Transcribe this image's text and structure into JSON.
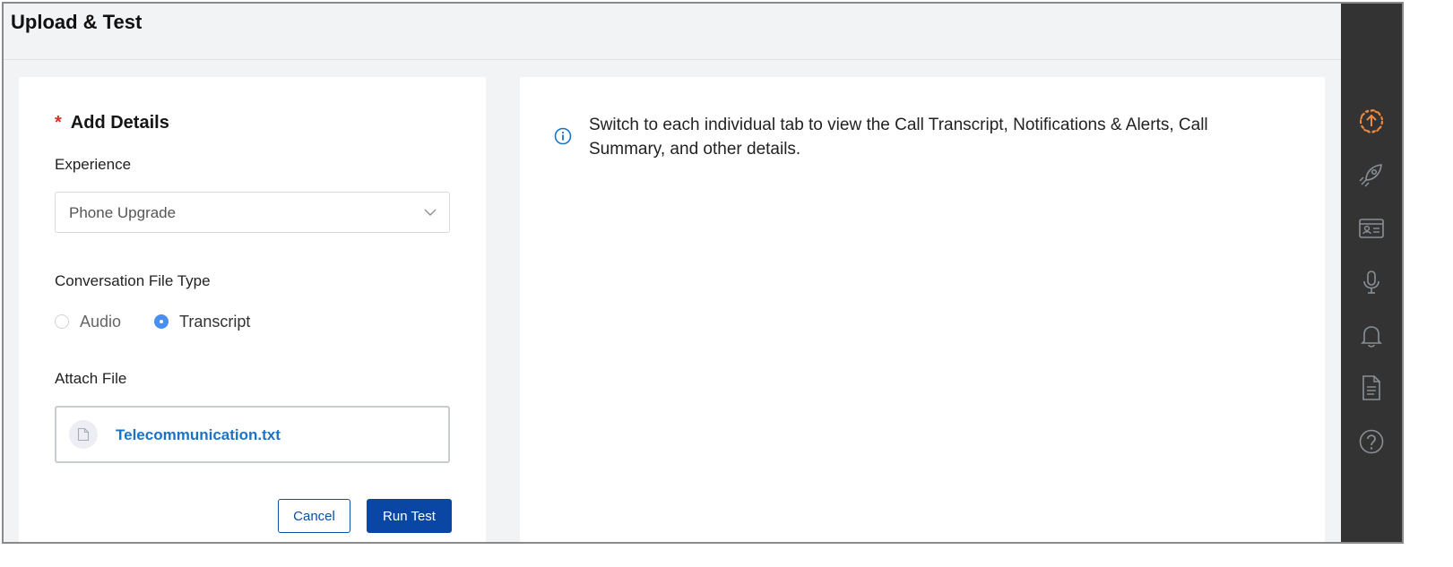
{
  "header": {
    "title": "Upload & Test"
  },
  "form": {
    "required_mark": "*",
    "section_title": "Add Details",
    "experience_label": "Experience",
    "experience_value": "Phone Upgrade",
    "file_type_label": "Conversation File Type",
    "file_type_options": [
      {
        "label": "Audio",
        "selected": false
      },
      {
        "label": "Transcript",
        "selected": true
      }
    ],
    "attach_label": "Attach File",
    "attached_file": "Telecommunication.txt",
    "cancel_label": "Cancel",
    "run_label": "Run Test"
  },
  "info": {
    "message": "Switch to each individual tab to view the Call Transcript, Notifications & Alerts, Call Summary, and other details."
  },
  "rail": {
    "icons": [
      "upload-icon",
      "rocket-icon",
      "id-card-icon",
      "microphone-icon",
      "bell-icon",
      "document-icon",
      "help-icon"
    ],
    "active": "upload-icon"
  },
  "colors": {
    "accent": "#0a47a5",
    "link": "#1b73c8",
    "active_rail": "#f08a3c",
    "rail_bg": "#333333",
    "required": "#d93025",
    "radio_selected": "#4a8ff0"
  }
}
